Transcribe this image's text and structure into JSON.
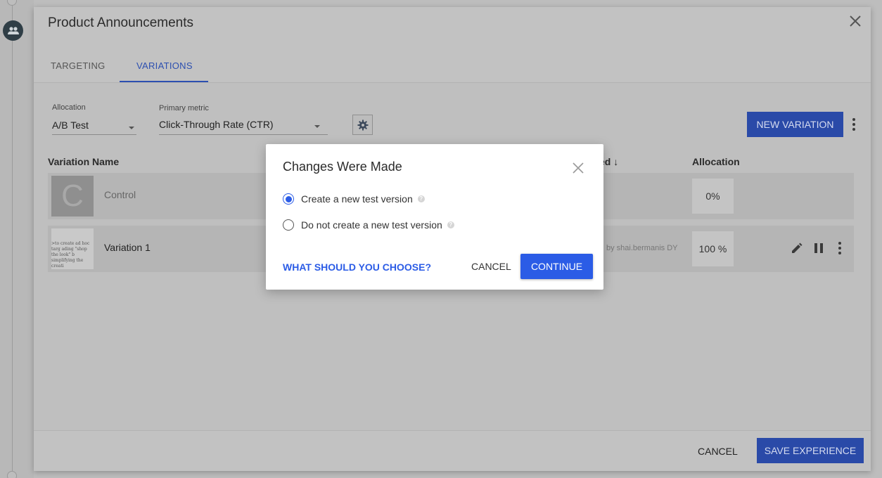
{
  "panel": {
    "title": "Product Announcements",
    "tabs": [
      {
        "label": "TARGETING"
      },
      {
        "label": "VARIATIONS"
      }
    ],
    "active_tab": "VARIATIONS"
  },
  "toolbar": {
    "allocation_label": "Allocation",
    "allocation_value": "A/B Test",
    "metric_label": "Primary metric",
    "metric_value": "Click-Through Rate (CTR)",
    "new_variation_label": "NEW VARIATION"
  },
  "table": {
    "headers": {
      "name": "Variation Name",
      "modified_partial": "ed ↓",
      "allocation": "Allocation"
    },
    "rows": [
      {
        "thumb_letter": "C",
        "name": "Control",
        "modified_by": "",
        "allocation": "0%"
      },
      {
        "thumb_text": ">to create ad hoc targ ading \"shop the look\" b simplifying the creati",
        "name": "Variation 1",
        "modified_by": "by shai.bermanis DY",
        "allocation": "100 %"
      }
    ]
  },
  "footer": {
    "cancel_label": "CANCEL",
    "save_label": "SAVE EXPERIENCE"
  },
  "modal": {
    "title": "Changes Were Made",
    "options": [
      {
        "label": "Create a new test version",
        "checked": true
      },
      {
        "label": "Do not create a new test version",
        "checked": false
      }
    ],
    "link_label": "WHAT SHOULD YOU CHOOSE?",
    "cancel_label": "CANCEL",
    "continue_label": "CONTINUE"
  },
  "colors": {
    "primary": "#2b5ce6",
    "primary_dimmed": "#2a4aa8",
    "overlay": "#bdbdbd"
  }
}
